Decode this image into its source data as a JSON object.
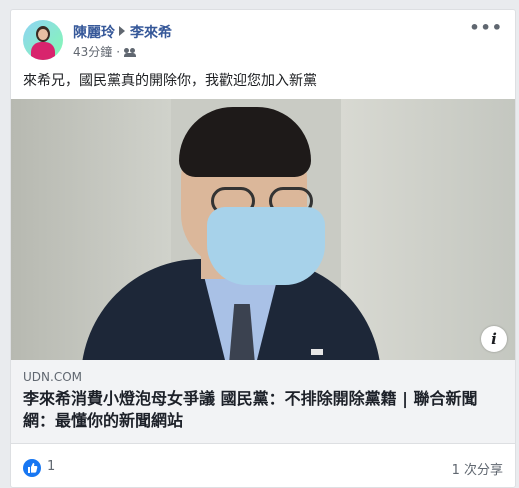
{
  "post": {
    "author": "陳麗玲",
    "target": "李來希",
    "time": "43分鐘",
    "separator": "·",
    "audience_icon": "friends-icon",
    "more_label": "•••",
    "text": "來希兄，國民黨真的開除你，我歡迎您加入新黨"
  },
  "link": {
    "domain": "UDN.COM",
    "title": "李來希消費小燈泡母女爭議 國民黨：不排除開除黨籍 | 聯合新聞網：最懂你的新聞網站",
    "info_label": "i"
  },
  "footer": {
    "like_icon": "thumbs-up-icon",
    "like_count": "1",
    "shares": "1 次分享"
  },
  "colors": {
    "name_blue": "#365899",
    "like_blue": "#1877f2"
  }
}
